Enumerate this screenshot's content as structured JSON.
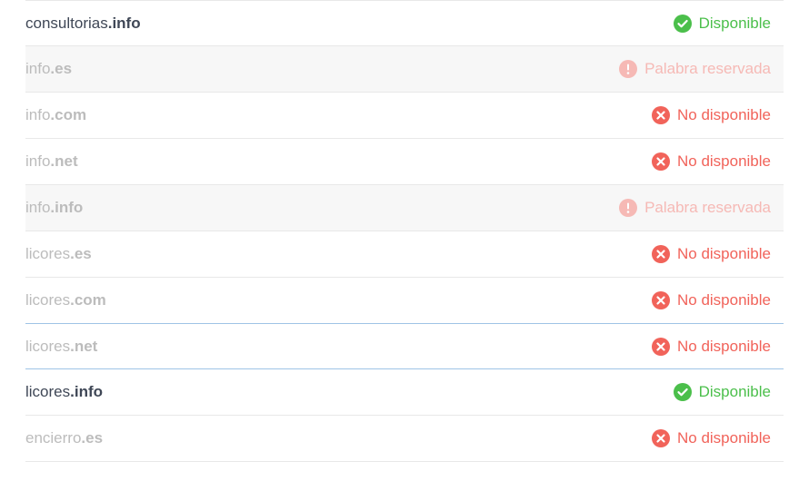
{
  "statusLabels": {
    "available": "Disponible",
    "unavailable": "No disponible",
    "reserved": "Palabra reservada"
  },
  "colors": {
    "available": "#4bbf4b",
    "unavailable": "#f1635a",
    "reserved": "#f6b9b5"
  },
  "domains": [
    {
      "name": "consultorias",
      "tld": ".info",
      "status": "available",
      "muted": false,
      "faded": false,
      "focused": false
    },
    {
      "name": "info",
      "tld": ".es",
      "status": "reserved",
      "muted": true,
      "faded": true,
      "focused": false
    },
    {
      "name": "info",
      "tld": ".com",
      "status": "unavailable",
      "muted": false,
      "faded": true,
      "focused": false
    },
    {
      "name": "info",
      "tld": ".net",
      "status": "unavailable",
      "muted": false,
      "faded": true,
      "focused": false
    },
    {
      "name": "info",
      "tld": ".info",
      "status": "reserved",
      "muted": true,
      "faded": true,
      "focused": false
    },
    {
      "name": "licores",
      "tld": ".es",
      "status": "unavailable",
      "muted": false,
      "faded": true,
      "focused": false
    },
    {
      "name": "licores",
      "tld": ".com",
      "status": "unavailable",
      "muted": false,
      "faded": true,
      "focused": false
    },
    {
      "name": "licores",
      "tld": ".net",
      "status": "unavailable",
      "muted": false,
      "faded": true,
      "focused": true
    },
    {
      "name": "licores",
      "tld": ".info",
      "status": "available",
      "muted": false,
      "faded": false,
      "focused": false
    },
    {
      "name": "encierro",
      "tld": ".es",
      "status": "unavailable",
      "muted": false,
      "faded": true,
      "focused": false
    }
  ]
}
